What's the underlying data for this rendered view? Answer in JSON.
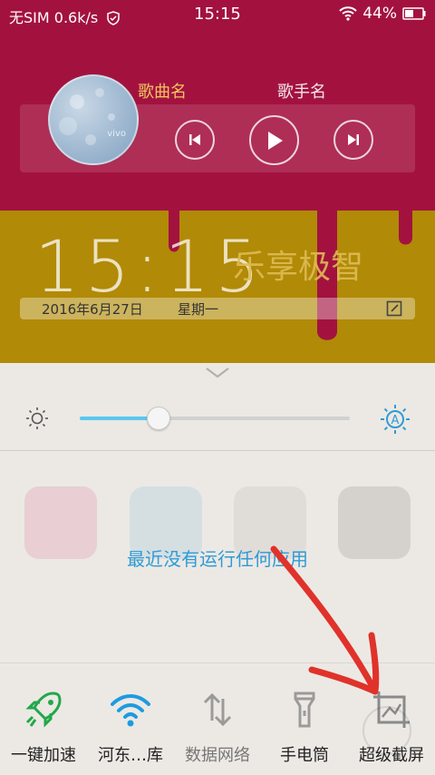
{
  "status": {
    "sim": "无SIM",
    "speed": "0.6k/s",
    "time": "15:15",
    "battery": "44%"
  },
  "music": {
    "song": "歌曲名",
    "artist": "歌手名",
    "album_brand": "vivo"
  },
  "lockscreen": {
    "clock": "15:15",
    "slogan": "乐享极智",
    "date": "2016年6月27日",
    "weekday": "星期一"
  },
  "brightness": {
    "level": 0.29
  },
  "recent": {
    "empty_message": "最近没有运行任何应用"
  },
  "quick_settings": [
    {
      "label": "一键加速",
      "icon": "rocket-icon",
      "color": "#21a84b",
      "active": true
    },
    {
      "label": "河东…库",
      "icon": "wifi-icon",
      "color": "#1e9be0",
      "active": true
    },
    {
      "label": "数据网络",
      "icon": "data-arrows-icon",
      "color": "#9a9a9a",
      "active": false
    },
    {
      "label": "手电筒",
      "icon": "flashlight-icon",
      "color": "#9a9a9a",
      "active": false
    },
    {
      "label": "超级截屏",
      "icon": "screenshot-icon",
      "color": "#9a9a9a",
      "active": false
    }
  ],
  "colors": {
    "wallpaper_red": "#a3123f",
    "wallpaper_gold": "#b18a07",
    "accent_blue": "#2f9bd6",
    "annotation_red": "#e0322a"
  }
}
